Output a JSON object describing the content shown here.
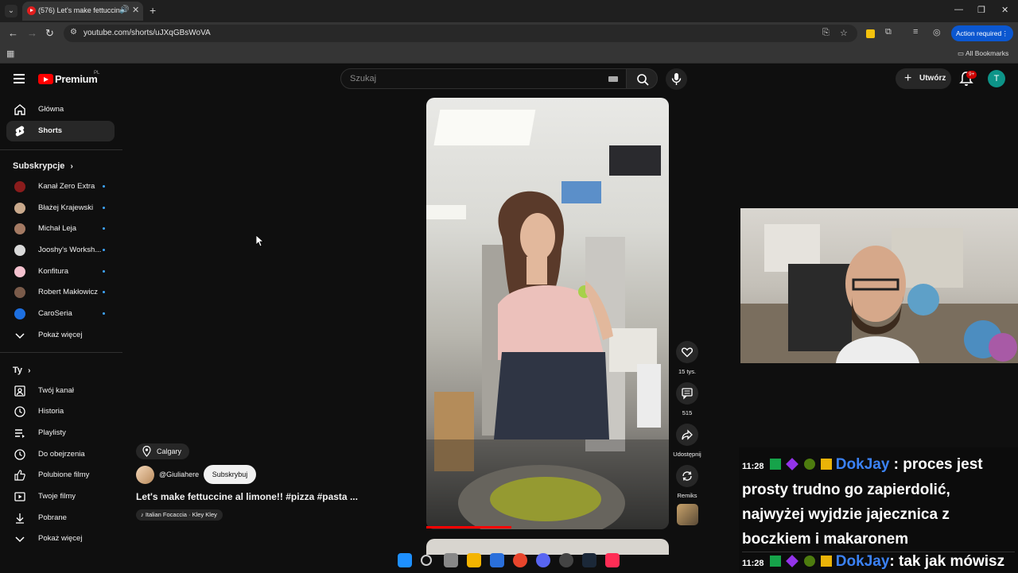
{
  "browser": {
    "tab_title": "(576) Let's make fettuccine",
    "url": "youtube.com/shorts/uJXqGBsWoVA",
    "action_required": "Action required",
    "all_bookmarks": "All Bookmarks"
  },
  "header": {
    "logo": "Premium",
    "logo_country": "PL",
    "search_placeholder": "Szukaj",
    "create_label": "Utwórz",
    "notifications_badge": "9+",
    "avatar_letter": "T"
  },
  "sidebar": {
    "main": [
      {
        "label": "Główna",
        "icon": "home-icon"
      },
      {
        "label": "Shorts",
        "icon": "shorts-icon",
        "active": true
      }
    ],
    "subscriptions_title": "Subskrypcje",
    "subscriptions": [
      {
        "label": "Kanał Zero Extra",
        "color": "#8a1c1c"
      },
      {
        "label": "Błażej Krajewski",
        "color": "#c9a98c"
      },
      {
        "label": "Michał Leja",
        "color": "#a47a63"
      },
      {
        "label": "Jooshy's Worksh...",
        "color": "#d9d9d9"
      },
      {
        "label": "Konfitura",
        "color": "#f4c2cf"
      },
      {
        "label": "Robert Makłowicz",
        "color": "#7a5b4a"
      },
      {
        "label": "CaroSeria",
        "color": "#1d6fe0"
      }
    ],
    "show_more_1": "Pokaż więcej",
    "you_title": "Ty",
    "you_items": [
      {
        "label": "Twój kanał",
        "icon": "account-icon"
      },
      {
        "label": "Historia",
        "icon": "history-icon"
      },
      {
        "label": "Playlisty",
        "icon": "playlist-icon"
      },
      {
        "label": "Do obejrzenia",
        "icon": "clock-icon"
      },
      {
        "label": "Polubione filmy",
        "icon": "thumbs-up-icon"
      },
      {
        "label": "Twoje filmy",
        "icon": "video-icon"
      },
      {
        "label": "Pobrane",
        "icon": "download-icon"
      }
    ],
    "show_more_2": "Pokaż więcej"
  },
  "short": {
    "location": "Calgary",
    "channel": "@Giuliahere",
    "subscribe": "Subskrybuj",
    "title": "Let's make fettuccine al limone!! #pizza #pasta ...",
    "music": "♪ Italian Focaccia · Kley Kley",
    "likes": "15 tys.",
    "comments": "515",
    "share": "Udostępnij",
    "remix": "Remiks",
    "progress_fraction": 0.35
  },
  "chat": {
    "messages": [
      {
        "time": "11:28",
        "user": "DokJay",
        "text": " : proces jest prosty trudno go zapierdolić, najwyżej wyjdzie jajecznica z boczkiem i makaronem"
      },
      {
        "time": "11:28",
        "user": "DokJay",
        "text": ": tak jak mówisz"
      }
    ]
  }
}
